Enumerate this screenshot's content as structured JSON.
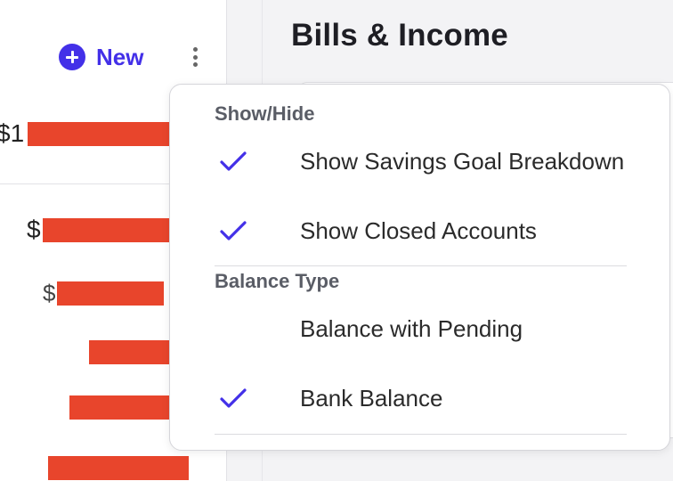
{
  "app": {
    "new_button_label": "New",
    "page_title": "Bills & Income"
  },
  "accounts": {
    "total_prefix": "$1",
    "rows": [
      {
        "prefix": "$"
      },
      {
        "prefix": "$"
      },
      {
        "prefix": ""
      },
      {
        "prefix": ""
      },
      {
        "prefix": ""
      }
    ]
  },
  "menu": {
    "show_hide": {
      "header": "Show/Hide",
      "items": [
        {
          "label": "Show Savings Goal Breakdown",
          "checked": true
        },
        {
          "label": "Show Closed Accounts",
          "checked": true
        }
      ]
    },
    "balance_type": {
      "header": "Balance Type",
      "items": [
        {
          "label": "Balance with Pending",
          "checked": false
        },
        {
          "label": "Bank Balance",
          "checked": true
        }
      ]
    }
  },
  "colors": {
    "accent": "#4330e8",
    "redaction": "#e8452c"
  },
  "icons": {
    "new": "plus-circle-icon",
    "more": "kebab-menu-icon",
    "check": "checkmark-icon"
  }
}
